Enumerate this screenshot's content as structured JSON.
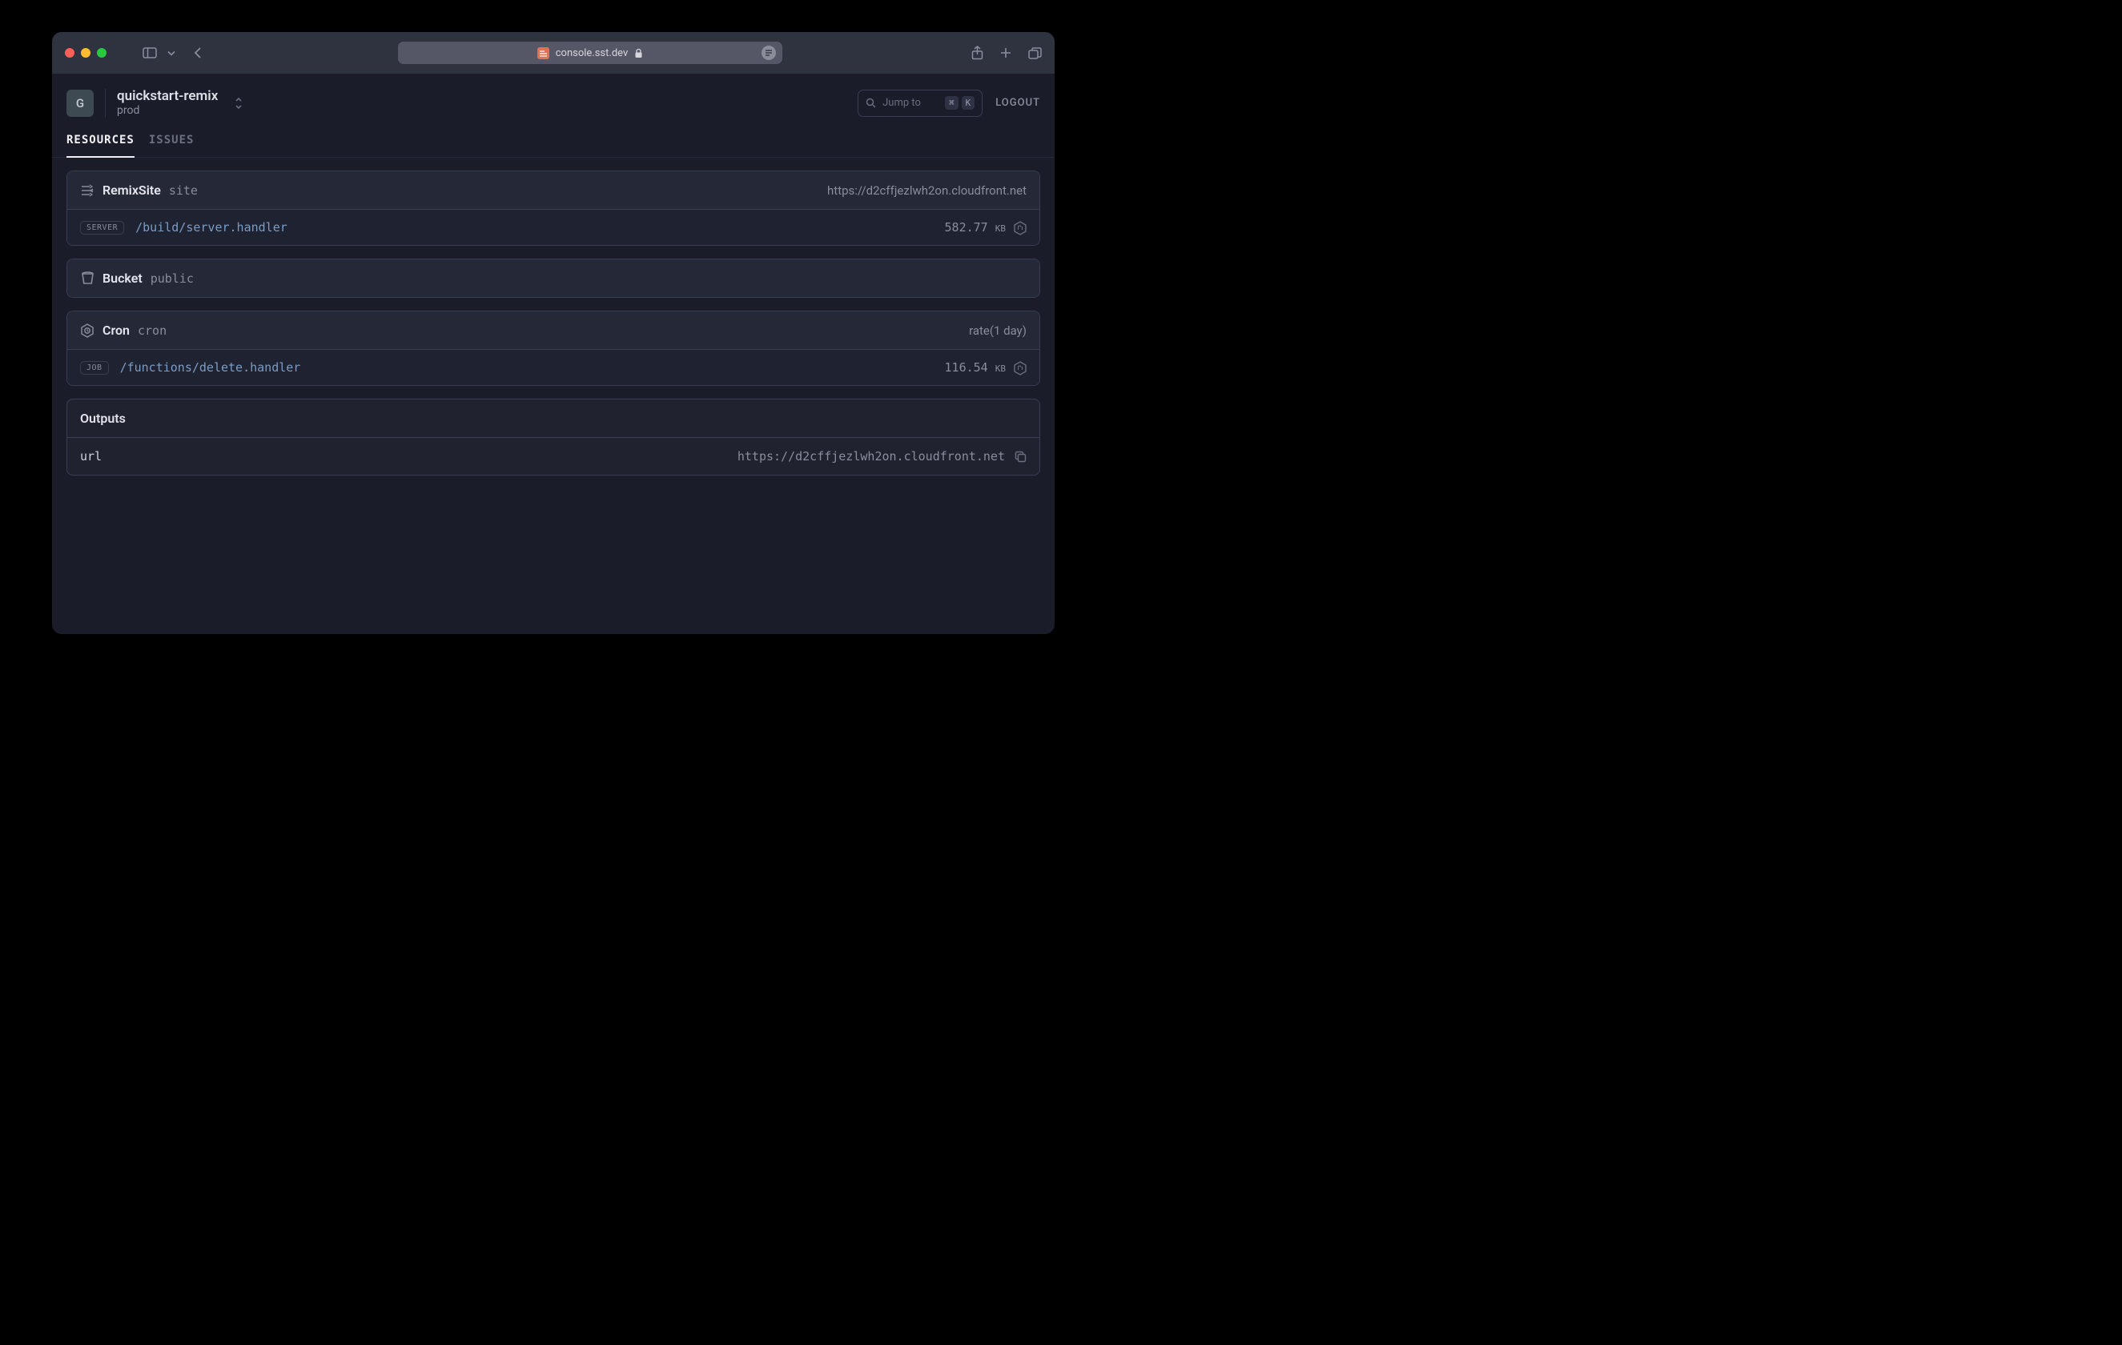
{
  "browser": {
    "address": "console.sst.dev"
  },
  "header": {
    "avatar_letter": "G",
    "project_name": "quickstart-remix",
    "stage": "prod",
    "jump_label": "Jump to",
    "jump_kbd1": "⌘",
    "jump_kbd2": "K",
    "logout_label": "LOGOUT"
  },
  "tabs": {
    "resources": "RESOURCES",
    "issues": "ISSUES"
  },
  "resources": [
    {
      "type": "RemixSite",
      "name": "site",
      "right": "https://d2cffjezlwh2on.cloudfront.net",
      "rows": [
        {
          "badge": "SERVER",
          "path": "/build/server.handler",
          "size": "582.77",
          "size_unit": "KB"
        }
      ]
    },
    {
      "type": "Bucket",
      "name": "public",
      "right": "",
      "rows": []
    },
    {
      "type": "Cron",
      "name": "cron",
      "right": "rate(1 day)",
      "rows": [
        {
          "badge": "JOB",
          "path": "/functions/delete.handler",
          "size": "116.54",
          "size_unit": "KB"
        }
      ]
    }
  ],
  "outputs_label": "Outputs",
  "outputs": [
    {
      "key": "url",
      "value": "https://d2cffjezlwh2on.cloudfront.net"
    }
  ]
}
